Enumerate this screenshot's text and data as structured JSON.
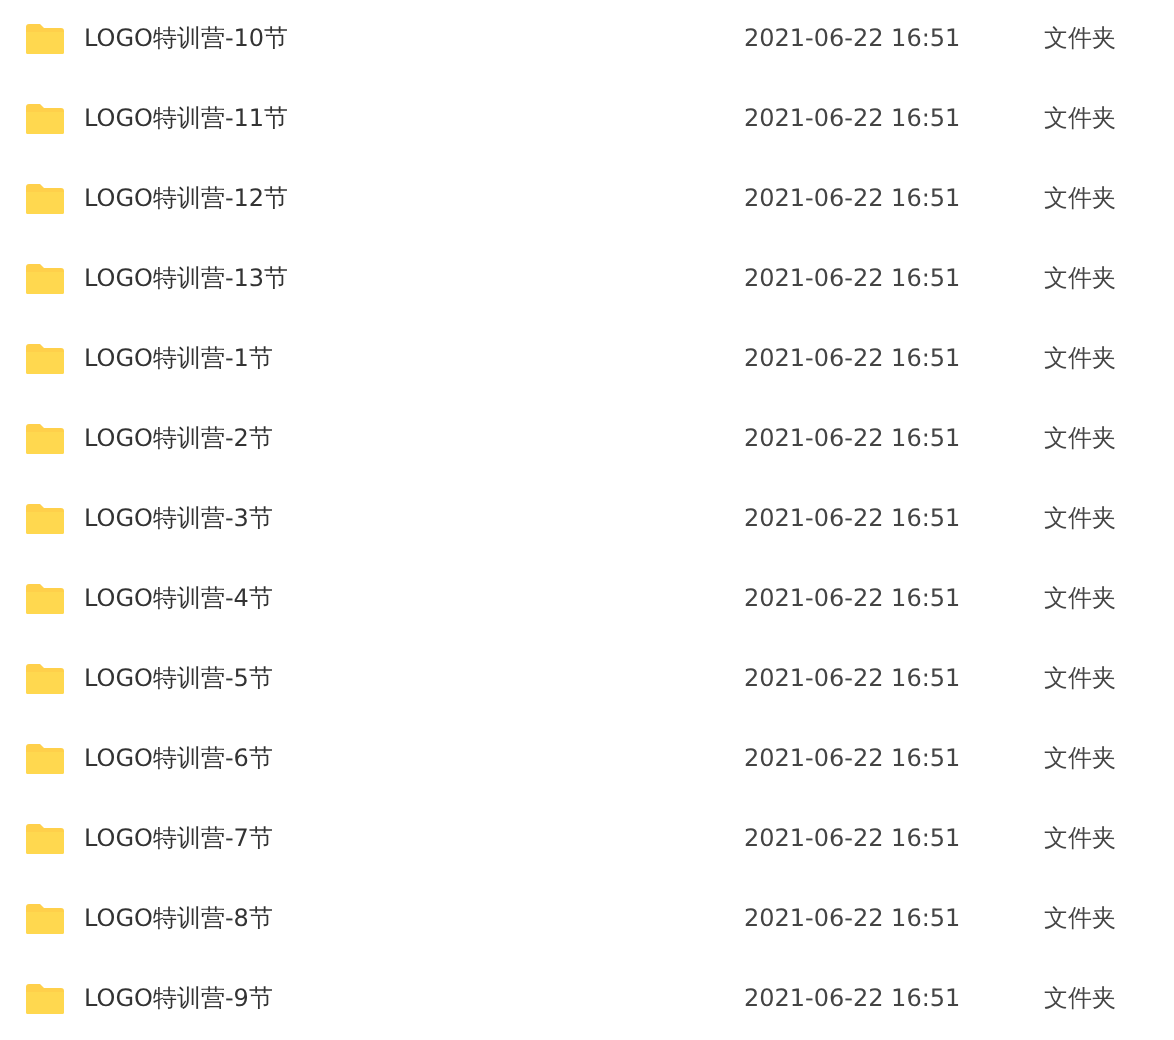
{
  "files": [
    {
      "name": "LOGO特训营-10节",
      "modified": "2021-06-22 16:51",
      "type": "文件夹"
    },
    {
      "name": "LOGO特训营-11节",
      "modified": "2021-06-22 16:51",
      "type": "文件夹"
    },
    {
      "name": "LOGO特训营-12节",
      "modified": "2021-06-22 16:51",
      "type": "文件夹"
    },
    {
      "name": "LOGO特训营-13节",
      "modified": "2021-06-22 16:51",
      "type": "文件夹"
    },
    {
      "name": "LOGO特训营-1节",
      "modified": "2021-06-22 16:51",
      "type": "文件夹"
    },
    {
      "name": "LOGO特训营-2节",
      "modified": "2021-06-22 16:51",
      "type": "文件夹"
    },
    {
      "name": "LOGO特训营-3节",
      "modified": "2021-06-22 16:51",
      "type": "文件夹"
    },
    {
      "name": "LOGO特训营-4节",
      "modified": "2021-06-22 16:51",
      "type": "文件夹"
    },
    {
      "name": "LOGO特训营-5节",
      "modified": "2021-06-22 16:51",
      "type": "文件夹"
    },
    {
      "name": "LOGO特训营-6节",
      "modified": "2021-06-22 16:51",
      "type": "文件夹"
    },
    {
      "name": "LOGO特训营-7节",
      "modified": "2021-06-22 16:51",
      "type": "文件夹"
    },
    {
      "name": "LOGO特训营-8节",
      "modified": "2021-06-22 16:51",
      "type": "文件夹"
    },
    {
      "name": "LOGO特训营-9节",
      "modified": "2021-06-22 16:51",
      "type": "文件夹"
    }
  ]
}
